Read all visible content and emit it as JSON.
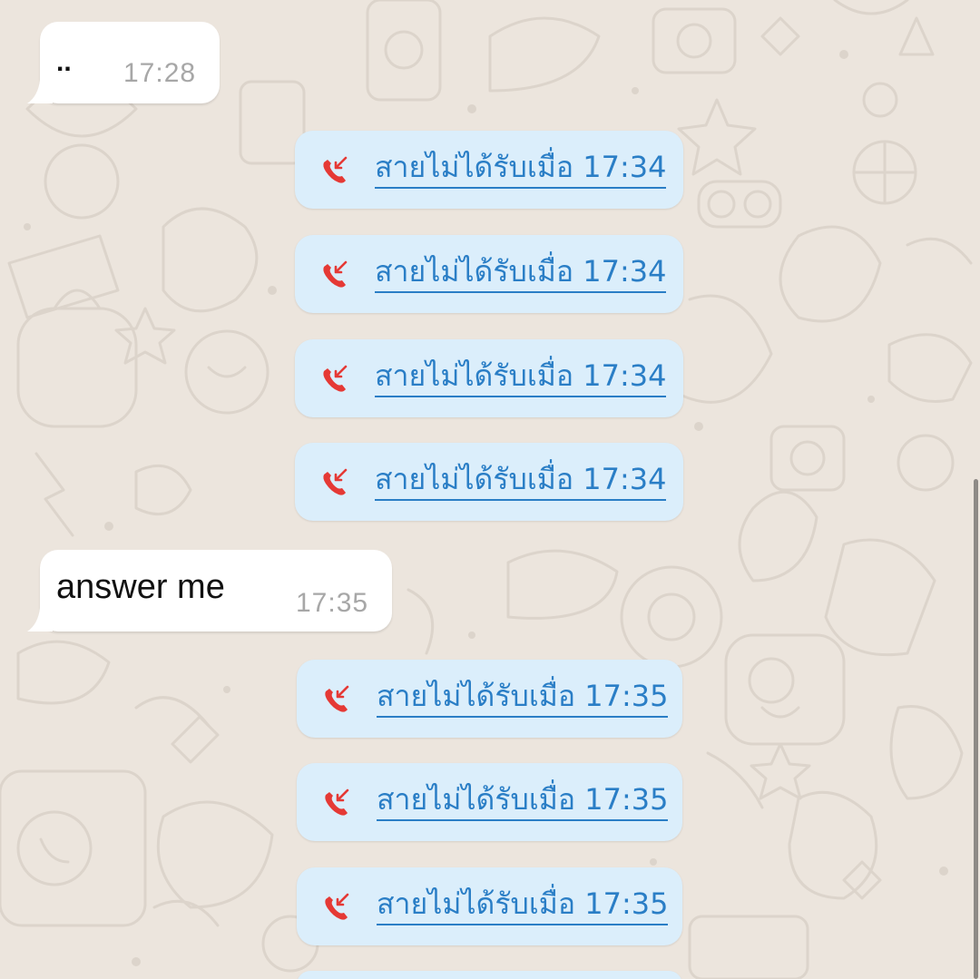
{
  "colors": {
    "chat_background": "#ece5dd",
    "incoming_bubble": "#ffffff",
    "call_bubble": "#dbeefb",
    "call_link": "#2a7ec6",
    "missed_call_icon": "#e53935",
    "timestamp": "#a7a7a7"
  },
  "messages": [
    {
      "text": "..",
      "time": "17:28"
    },
    {
      "text": "answer me",
      "time": "17:35"
    }
  ],
  "calls": [
    {
      "icon": "missed-call-icon",
      "label": "สายไม่ได้รับเมื่อ 17:34"
    },
    {
      "icon": "missed-call-icon",
      "label": "สายไม่ได้รับเมื่อ 17:34"
    },
    {
      "icon": "missed-call-icon",
      "label": "สายไม่ได้รับเมื่อ 17:34"
    },
    {
      "icon": "missed-call-icon",
      "label": "สายไม่ได้รับเมื่อ 17:34"
    },
    {
      "icon": "missed-call-icon",
      "label": "สายไม่ได้รับเมื่อ 17:35"
    },
    {
      "icon": "missed-call-icon",
      "label": "สายไม่ได้รับเมื่อ 17:35"
    },
    {
      "icon": "missed-call-icon",
      "label": "สายไม่ได้รับเมื่อ 17:35"
    }
  ]
}
